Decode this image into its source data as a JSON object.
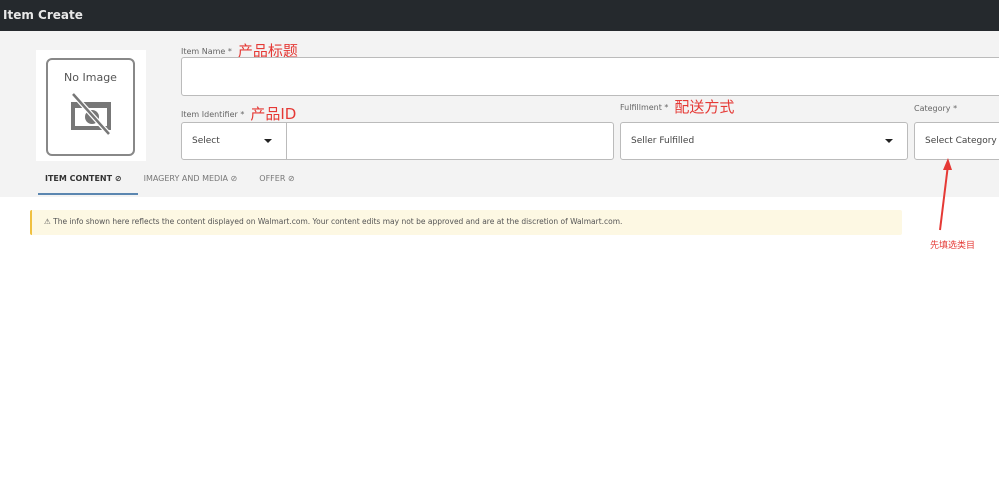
{
  "header": {
    "title": "Item Create"
  },
  "image": {
    "no_image": "No Image"
  },
  "fields": {
    "item_name": {
      "label": "Item Name *",
      "annotation": "产品标题",
      "value": ""
    },
    "item_identifier": {
      "label": "Item Identifier *",
      "annotation": "产品ID",
      "select": "Select",
      "value": ""
    },
    "fulfillment": {
      "label": "Fulfillment *",
      "annotation": "配送方式",
      "value": "Seller Fulfilled"
    },
    "category": {
      "label": "Category *",
      "value": "Select Category"
    }
  },
  "tabs": [
    {
      "label": "ITEM CONTENT ⊘"
    },
    {
      "label": "IMAGERY AND MEDIA ⊘"
    },
    {
      "label": "OFFER ⊘"
    }
  ],
  "alert": {
    "text": "The info shown here reflects the content displayed on Walmart.com. Your content edits may not be approved and are at the discretion of Walmart.com."
  },
  "annotation": {
    "category_note": "先填选类目"
  }
}
